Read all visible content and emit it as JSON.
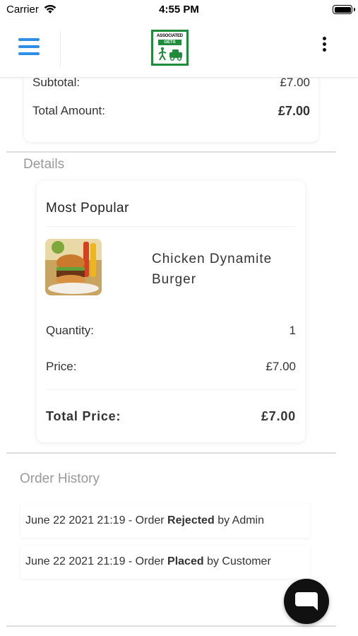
{
  "status_bar": {
    "carrier": "Carrier",
    "time": "4:55 PM"
  },
  "header": {
    "logo_top_text": "ASSOCIATED",
    "logo_mid_text": "GETS",
    "menu_icon": "hamburger-icon",
    "more_icon": "kebab-menu-icon"
  },
  "summary": {
    "subtotal_label": "Subtotal:",
    "subtotal_value": "£7.00",
    "total_label": "Total Amount:",
    "total_value": "£7.00"
  },
  "details": {
    "section_title": "Details",
    "category": "Most Popular",
    "product_name": "Chicken Dynamite Burger",
    "quantity_label": "Quantity:",
    "quantity_value": "1",
    "price_label": "Price:",
    "price_value": "£7.00",
    "total_label": "Total Price:",
    "total_value": "£7.00"
  },
  "order_history": {
    "section_title": "Order History",
    "items": [
      {
        "prefix": "June 22 2021 21:19 - Order",
        "status": "Rejected",
        "suffix": "by Admin"
      },
      {
        "prefix": "June 22 2021 21:19 - Order",
        "status": "Placed",
        "suffix": "by Customer"
      }
    ]
  },
  "colors": {
    "accent": "#2d8fe5",
    "logo_green": "#1e8c3a",
    "fab": "#111111"
  }
}
